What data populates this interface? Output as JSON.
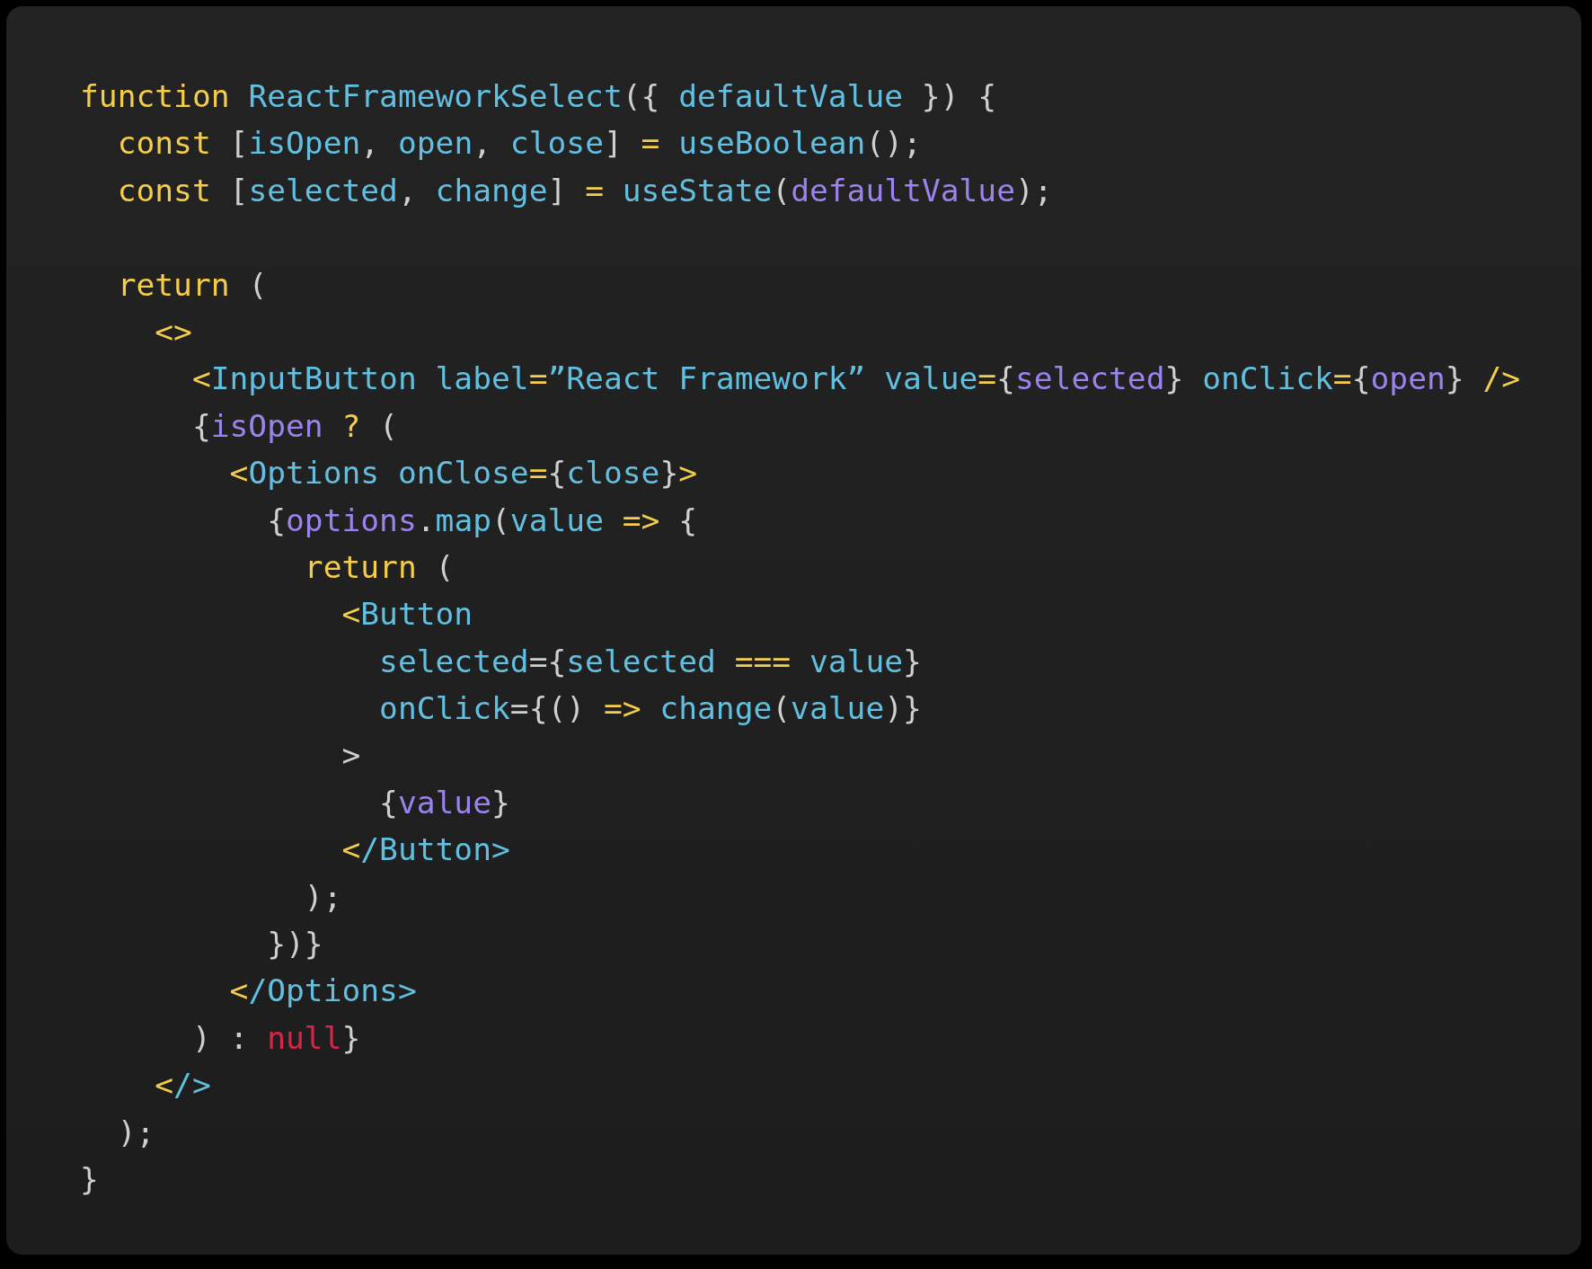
{
  "code_lines": [
    {
      "kind": "code",
      "tokens": [
        {
          "kind": "kw",
          "text": "function "
        },
        {
          "kind": "fn",
          "text": "ReactFrameworkSelect"
        },
        {
          "kind": "pu",
          "text": "({ "
        },
        {
          "kind": "fn",
          "text": "defaultValue"
        },
        {
          "kind": "pu",
          "text": " }) {"
        }
      ]
    },
    {
      "kind": "code",
      "tokens": [
        {
          "kind": "kw",
          "text": "  const "
        },
        {
          "kind": "pu",
          "text": "["
        },
        {
          "kind": "fn",
          "text": "isOpen"
        },
        {
          "kind": "pu",
          "text": ", "
        },
        {
          "kind": "fn",
          "text": "open"
        },
        {
          "kind": "pu",
          "text": ", "
        },
        {
          "kind": "fn",
          "text": "close"
        },
        {
          "kind": "pu",
          "text": "] "
        },
        {
          "kind": "kw",
          "text": "="
        },
        {
          "kind": "fn",
          "text": " useBoolean"
        },
        {
          "kind": "pu",
          "text": "();"
        }
      ]
    },
    {
      "kind": "code",
      "tokens": [
        {
          "kind": "kw",
          "text": "  const "
        },
        {
          "kind": "pu",
          "text": "["
        },
        {
          "kind": "fn",
          "text": "selected"
        },
        {
          "kind": "pu",
          "text": ", "
        },
        {
          "kind": "fn",
          "text": "change"
        },
        {
          "kind": "pu",
          "text": "] "
        },
        {
          "kind": "kw",
          "text": "="
        },
        {
          "kind": "fn",
          "text": " useState"
        },
        {
          "kind": "pu",
          "text": "("
        },
        {
          "kind": "va",
          "text": "defaultValue"
        },
        {
          "kind": "pu",
          "text": ");"
        }
      ]
    },
    {
      "kind": "blank"
    },
    {
      "kind": "code",
      "tokens": [
        {
          "kind": "kw",
          "text": "  return "
        },
        {
          "kind": "pu",
          "text": "("
        }
      ]
    },
    {
      "kind": "code",
      "tokens": [
        {
          "kind": "kw",
          "text": "    <>"
        }
      ]
    },
    {
      "kind": "code",
      "tokens": [
        {
          "kind": "kw",
          "text": "      <"
        },
        {
          "kind": "fn",
          "text": "InputButton label"
        },
        {
          "kind": "kw",
          "text": "="
        },
        {
          "kind": "fn",
          "text": "”React Framework” value"
        },
        {
          "kind": "kw",
          "text": "="
        },
        {
          "kind": "pu",
          "text": "{"
        },
        {
          "kind": "va",
          "text": "selected"
        },
        {
          "kind": "pu",
          "text": "} "
        },
        {
          "kind": "fn",
          "text": "onClick"
        },
        {
          "kind": "kw",
          "text": "="
        },
        {
          "kind": "pu",
          "text": "{"
        },
        {
          "kind": "va",
          "text": "open"
        },
        {
          "kind": "pu",
          "text": "} "
        },
        {
          "kind": "kw",
          "text": "/>"
        }
      ]
    },
    {
      "kind": "code",
      "tokens": [
        {
          "kind": "pu",
          "text": "      {"
        },
        {
          "kind": "va",
          "text": "isOpen"
        },
        {
          "kind": "kw",
          "text": " ?"
        },
        {
          "kind": "pu",
          "text": " ("
        }
      ]
    },
    {
      "kind": "code",
      "tokens": [
        {
          "kind": "kw",
          "text": "        <"
        },
        {
          "kind": "fn",
          "text": "Options onClose"
        },
        {
          "kind": "kw",
          "text": "="
        },
        {
          "kind": "pu",
          "text": "{"
        },
        {
          "kind": "fn",
          "text": "close"
        },
        {
          "kind": "pu",
          "text": "}"
        },
        {
          "kind": "kw",
          "text": ">"
        }
      ]
    },
    {
      "kind": "code",
      "tokens": [
        {
          "kind": "pu",
          "text": "          {"
        },
        {
          "kind": "va",
          "text": "options"
        },
        {
          "kind": "pu",
          "text": "."
        },
        {
          "kind": "fn",
          "text": "map"
        },
        {
          "kind": "pu",
          "text": "("
        },
        {
          "kind": "fn",
          "text": "value "
        },
        {
          "kind": "kw",
          "text": "=>"
        },
        {
          "kind": "pu",
          "text": " {"
        }
      ]
    },
    {
      "kind": "code",
      "tokens": [
        {
          "kind": "kw",
          "text": "            return "
        },
        {
          "kind": "pu",
          "text": "("
        }
      ]
    },
    {
      "kind": "code",
      "tokens": [
        {
          "kind": "kw",
          "text": "              <"
        },
        {
          "kind": "fn",
          "text": "Button"
        }
      ]
    },
    {
      "kind": "code",
      "tokens": [
        {
          "kind": "fn",
          "text": "                selected"
        },
        {
          "kind": "pu",
          "text": "={"
        },
        {
          "kind": "fn",
          "text": "selected "
        },
        {
          "kind": "kw",
          "text": "==="
        },
        {
          "kind": "fn",
          "text": " value"
        },
        {
          "kind": "pu",
          "text": "}"
        }
      ]
    },
    {
      "kind": "code",
      "tokens": [
        {
          "kind": "fn",
          "text": "                onClick"
        },
        {
          "kind": "pu",
          "text": "={() "
        },
        {
          "kind": "kw",
          "text": "=>"
        },
        {
          "kind": "fn",
          "text": " change"
        },
        {
          "kind": "pu",
          "text": "("
        },
        {
          "kind": "fn",
          "text": "value"
        },
        {
          "kind": "pu",
          "text": ")}"
        }
      ]
    },
    {
      "kind": "code",
      "tokens": [
        {
          "kind": "pu",
          "text": "              >"
        }
      ]
    },
    {
      "kind": "code",
      "tokens": [
        {
          "kind": "pu",
          "text": "                {"
        },
        {
          "kind": "va",
          "text": "value"
        },
        {
          "kind": "pu",
          "text": "}"
        }
      ]
    },
    {
      "kind": "code",
      "tokens": [
        {
          "kind": "kw",
          "text": "              <"
        },
        {
          "kind": "fn",
          "text": "/Button>"
        }
      ]
    },
    {
      "kind": "code",
      "tokens": [
        {
          "kind": "pu",
          "text": "            );"
        }
      ]
    },
    {
      "kind": "code",
      "tokens": [
        {
          "kind": "pu",
          "text": "          })}"
        }
      ]
    },
    {
      "kind": "code",
      "tokens": [
        {
          "kind": "kw",
          "text": "        <"
        },
        {
          "kind": "fn",
          "text": "/Options>"
        }
      ]
    },
    {
      "kind": "code",
      "tokens": [
        {
          "kind": "pu",
          "text": "      ) : "
        },
        {
          "kind": "nu",
          "text": "null"
        },
        {
          "kind": "pu",
          "text": "}"
        }
      ]
    },
    {
      "kind": "code",
      "tokens": [
        {
          "kind": "kw",
          "text": "    <"
        },
        {
          "kind": "fn",
          "text": "/>"
        }
      ]
    },
    {
      "kind": "code",
      "tokens": [
        {
          "kind": "pu",
          "text": "  );"
        }
      ]
    },
    {
      "kind": "code",
      "tokens": [
        {
          "kind": "pu",
          "text": "}"
        }
      ]
    }
  ]
}
